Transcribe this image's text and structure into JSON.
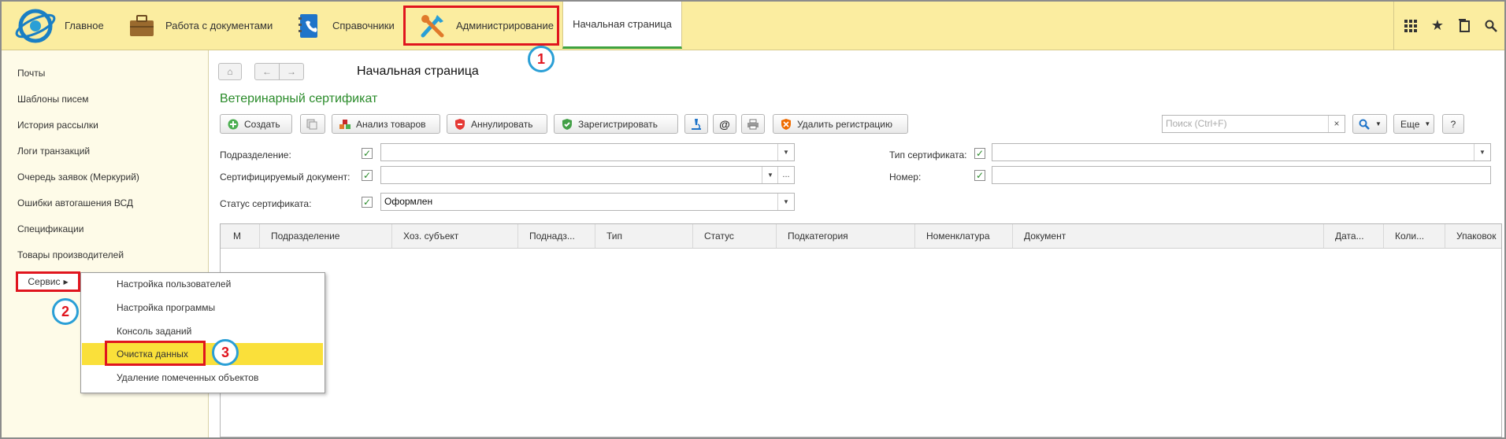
{
  "sections": {
    "home": "Главное",
    "docs": "Работа с документами",
    "refs": "Справочники",
    "admin": "Администрирование"
  },
  "open_tab": "Начальная страница",
  "sidebar": {
    "items": [
      "Почты",
      "Шаблоны писем",
      "История рассылки",
      "Логи транзакций",
      "Очередь заявок (Меркурий)",
      "Ошибки автогашения ВСД",
      "Спецификации",
      "Товары производителей"
    ],
    "service": "Сервис"
  },
  "service_menu": [
    "Настройка пользователей",
    "Настройка программы",
    "Консоль заданий",
    "Очистка данных",
    "Удаление помеченных объектов"
  ],
  "badges": [
    "1",
    "2",
    "3"
  ],
  "breadcrumb": "Начальная страница",
  "doc_title": "Ветеринарный сертификат",
  "toolbar": {
    "create": "Создать",
    "analyze": "Анализ товаров",
    "cancel": "Аннулировать",
    "register": "Зарегистрировать",
    "at": "@",
    "delete_reg": "Удалить регистрацию",
    "search_placeholder": "Поиск (Ctrl+F)",
    "search_clear": "×",
    "more": "Еще",
    "help": "?"
  },
  "filters": {
    "division_label": "Подразделение:",
    "certified_doc_label": "Сертифицируемый документ:",
    "status_label": "Статус сертификата:",
    "status_value": "Оформлен",
    "cert_type_label": "Тип сертификата:",
    "number_label": "Номер:",
    "ellipsis": "..."
  },
  "table_columns": [
    "М",
    "Подразделение",
    "Хоз. субъект",
    "Поднадз...",
    "Тип",
    "Статус",
    "Подкатегория",
    "Номенклатура",
    "Документ",
    "Дата...",
    "Коли...",
    "Упаковок"
  ],
  "colors": {
    "topbar": "#fbeda0",
    "highlight_red": "#e0151e",
    "badge_blue": "#2a9fd6",
    "selected_item": "#fae03a",
    "title_green": "#2a8b2a"
  }
}
